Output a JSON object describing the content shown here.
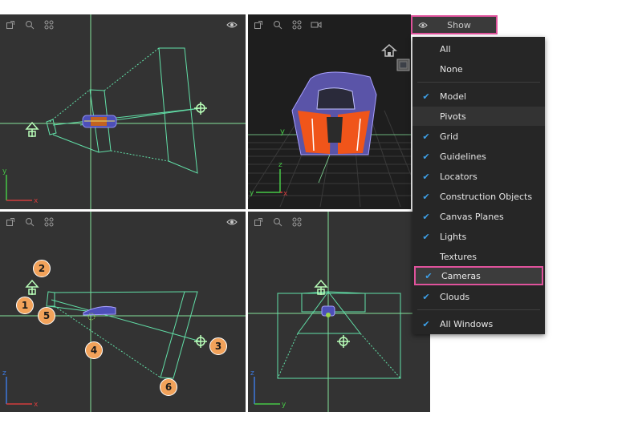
{
  "show_menu": {
    "title": "Show",
    "items": [
      {
        "label": "All",
        "checked": false
      },
      {
        "label": "None",
        "checked": false
      },
      {
        "label": "Model",
        "checked": true
      },
      {
        "label": "Pivots",
        "checked": false
      },
      {
        "label": "Grid",
        "checked": true
      },
      {
        "label": "Guidelines",
        "checked": true
      },
      {
        "label": "Locators",
        "checked": true
      },
      {
        "label": "Construction Objects",
        "checked": true
      },
      {
        "label": "Canvas Planes",
        "checked": true
      },
      {
        "label": "Lights",
        "checked": true
      },
      {
        "label": "Textures",
        "checked": false
      },
      {
        "label": "Cameras",
        "checked": true
      },
      {
        "label": "Clouds",
        "checked": true
      },
      {
        "label": "All Windows",
        "checked": true
      }
    ],
    "check_glyph": "✔"
  },
  "callouts": [
    "1",
    "2",
    "3",
    "4",
    "5",
    "6"
  ],
  "axes": {
    "top": {
      "vertical": "y",
      "horizontal": "x"
    },
    "perspective": {
      "vertical": "z",
      "horizontal": "x",
      "extra": "y"
    },
    "front": {
      "vertical": "z",
      "horizontal": "x"
    },
    "side": {
      "vertical": "z",
      "horizontal": "y"
    }
  },
  "colors": {
    "viewport_bg": "#333333",
    "perspective_bg": "#1e1e1e",
    "guideline": "#86e39b",
    "camera_frustum": "#62e0a8",
    "highlight_border": "#e0529c",
    "checkmark": "#3da0e8",
    "callout": "#f2a25a"
  },
  "icons": {
    "maximize": "maximize-icon",
    "search": "search-icon",
    "frame": "frame-icon",
    "camera": "camera-icon",
    "eye": "eye-icon",
    "home": "home-icon"
  }
}
